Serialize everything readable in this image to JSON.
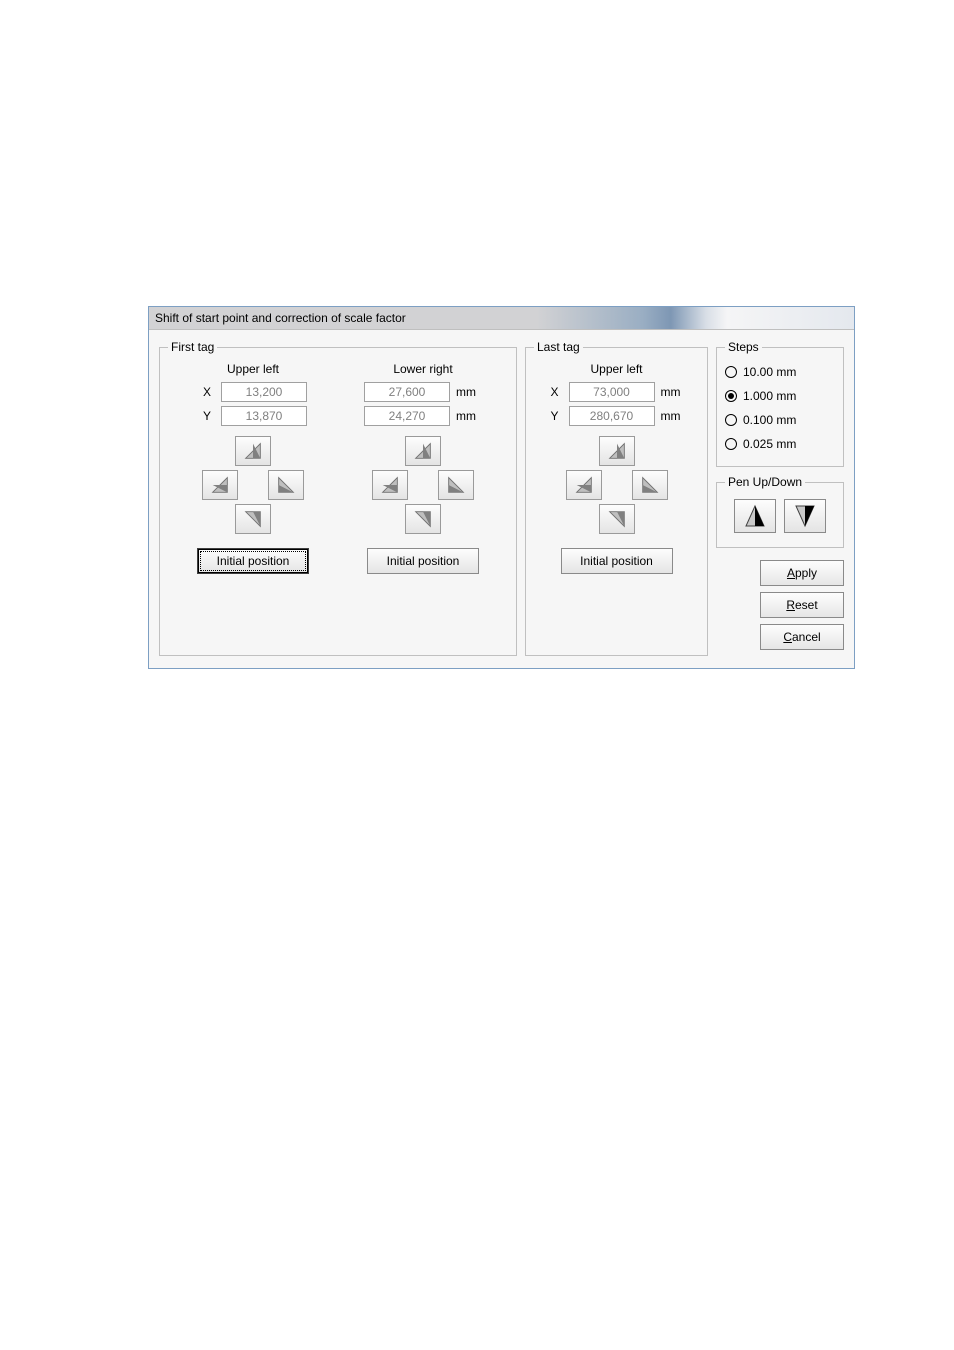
{
  "title": "Shift of start point and correction of scale factor",
  "first_tag": {
    "legend": "First tag",
    "upper_left": {
      "title": "Upper left",
      "x_label": "X",
      "y_label": "Y",
      "x_value": "13,200",
      "y_value": "13,870",
      "unit": "",
      "initial_btn": "Initial position"
    },
    "lower_right": {
      "title": "Lower right",
      "x_value": "27,600",
      "y_value": "24,270",
      "unit": "mm",
      "initial_btn": "Initial position"
    }
  },
  "last_tag": {
    "legend": "Last tag",
    "upper_left": {
      "title": "Upper left",
      "x_label": "X",
      "y_label": "Y",
      "x_value": "73,000",
      "y_value": "280,670",
      "unit": "mm",
      "initial_btn": "Initial position"
    }
  },
  "steps": {
    "legend": "Steps",
    "options": [
      "10.00 mm",
      "1.000 mm",
      "0.100 mm",
      "0.025 mm"
    ],
    "selected_index": 1
  },
  "pen": {
    "legend": "Pen Up/Down"
  },
  "actions": {
    "apply": "Apply",
    "apply_mn": "A",
    "reset": "Reset",
    "reset_mn": "R",
    "cancel": "Cancel",
    "cancel_mn": "C"
  }
}
